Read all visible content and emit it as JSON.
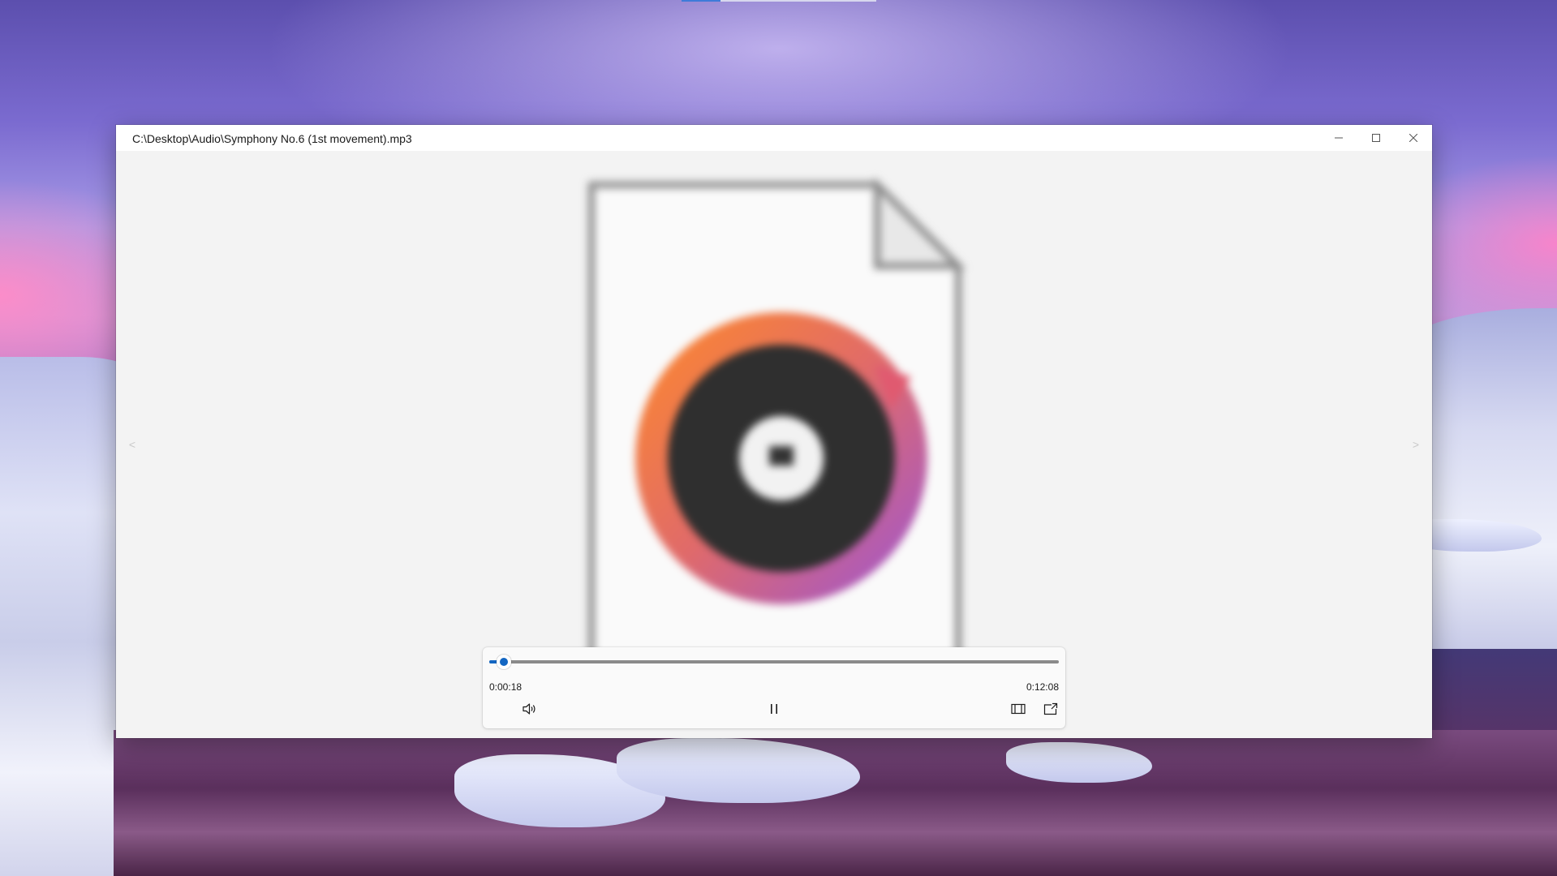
{
  "window": {
    "title": "C:\\Desktop\\Audio\\Symphony No.6 (1st movement).mp3",
    "minimize_icon": "minimize-icon",
    "maximize_icon": "maximize-icon",
    "close_icon": "close-icon"
  },
  "navigation": {
    "previous_glyph": "<",
    "next_glyph": ">"
  },
  "preview": {
    "icon": "music-disc-file-icon"
  },
  "player": {
    "current_time": "0:00:18",
    "total_time": "0:12:08",
    "progress_fraction": 0.025,
    "accent_color": "#1366c2",
    "volume_icon": "speaker-volume-icon",
    "play_pause_icon": "pause-icon",
    "fit_icon": "fit-to-window-icon",
    "open_icon": "open-externally-icon"
  }
}
